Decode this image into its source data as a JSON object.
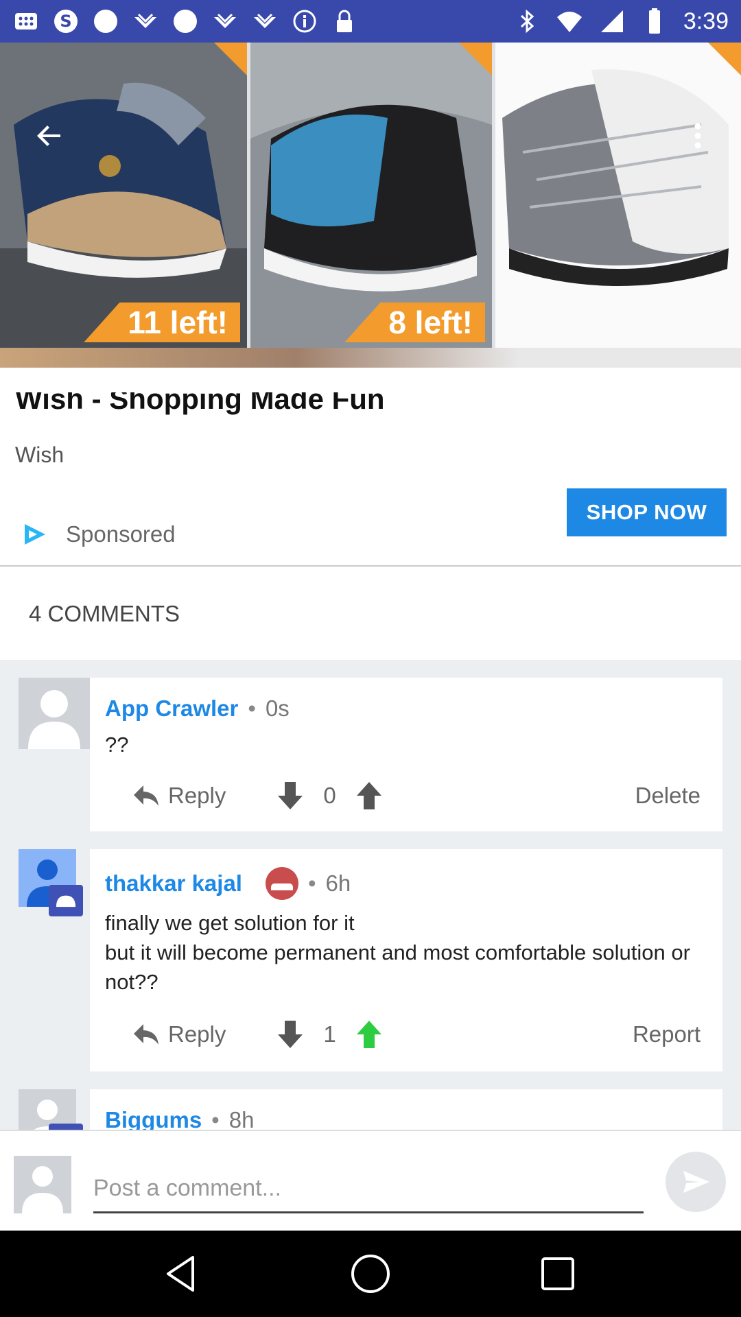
{
  "status_bar": {
    "time": "3:39",
    "left_icons": [
      "apps-grid-icon",
      "s-app-icon",
      "circle-icon",
      "bird-logo-icon",
      "circle-icon",
      "bird-logo-icon",
      "bird-logo-icon",
      "info-icon",
      "lock-icon"
    ],
    "right_icons": [
      "bluetooth-icon",
      "wifi-icon",
      "signal-icon",
      "battery-icon"
    ]
  },
  "ad": {
    "badges": [
      "11 left!",
      "8 left!"
    ],
    "title": "Wish - Shopping Made Fun",
    "brand": "Wish",
    "sponsored_label": "Sponsored",
    "cta_label": "SHOP NOW"
  },
  "comments_header": "4 COMMENTS",
  "comments": [
    {
      "author": "App Crawler",
      "separator": "•",
      "time": "0s",
      "text": "??",
      "reply_label": "Reply",
      "votes": "0",
      "action_label": "Delete",
      "upvoted": false
    },
    {
      "author": "thakkar kajal",
      "separator": "•",
      "time": "6h",
      "text": "finally we get solution for it\nbut it will become permanent and most comfortable solution or not??",
      "reply_label": "Reply",
      "votes": "1",
      "action_label": "Report",
      "upvoted": true
    },
    {
      "author": "Biggums",
      "separator": "•",
      "time": "8h"
    }
  ],
  "post_bar": {
    "placeholder": "Post a comment..."
  },
  "colors": {
    "accent": "#1e88e5",
    "status_bar": "#3949ab",
    "badge": "#f39c2d",
    "upvote_active": "#2ecc40"
  }
}
